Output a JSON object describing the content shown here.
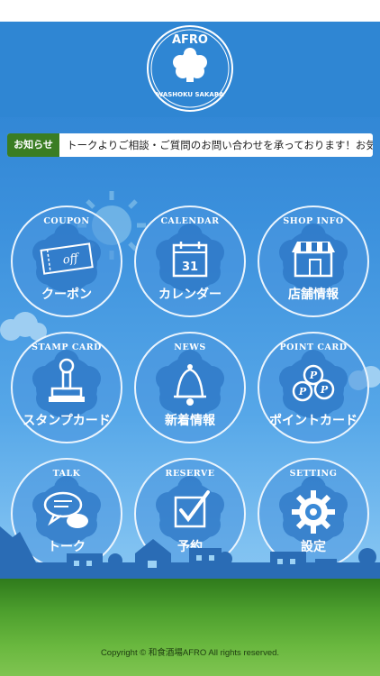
{
  "logo": {
    "top_text": "AFRO",
    "bottom_text": "WASHOKU SAKABA"
  },
  "news": {
    "label": "お知らせ",
    "text": "トークよりご相談・ご質問のお問い合わせを承っております！お気軽にご連"
  },
  "menu": [
    {
      "en": "COUPON",
      "jp": "クーポン",
      "icon": "coupon-ticket-icon",
      "icon_text": "off"
    },
    {
      "en": "CALENDAR",
      "jp": "カレンダー",
      "icon": "calendar-icon",
      "icon_text": "31"
    },
    {
      "en": "SHOP INFO",
      "jp": "店舗情報",
      "icon": "shop-icon"
    },
    {
      "en": "STAMP CARD",
      "jp": "スタンプカード",
      "icon": "stamp-icon"
    },
    {
      "en": "NEWS",
      "jp": "新着情報",
      "icon": "bell-icon"
    },
    {
      "en": "POINT CARD",
      "jp": "ポイントカード",
      "icon": "coins-icon",
      "icon_text": "P"
    },
    {
      "en": "TALK",
      "jp": "トーク",
      "icon": "speech-bubble-icon"
    },
    {
      "en": "RESERVE",
      "jp": "予約",
      "icon": "checkbox-icon"
    },
    {
      "en": "SETTING",
      "jp": "設定",
      "icon": "gear-icon"
    }
  ],
  "footer": {
    "copyright": "Copyright © 和食酒場AFRO All rights reserved."
  },
  "colors": {
    "header_blue": "#2f86d3",
    "news_label_green": "#3a7d23",
    "grass_green": "#4ea02e"
  }
}
